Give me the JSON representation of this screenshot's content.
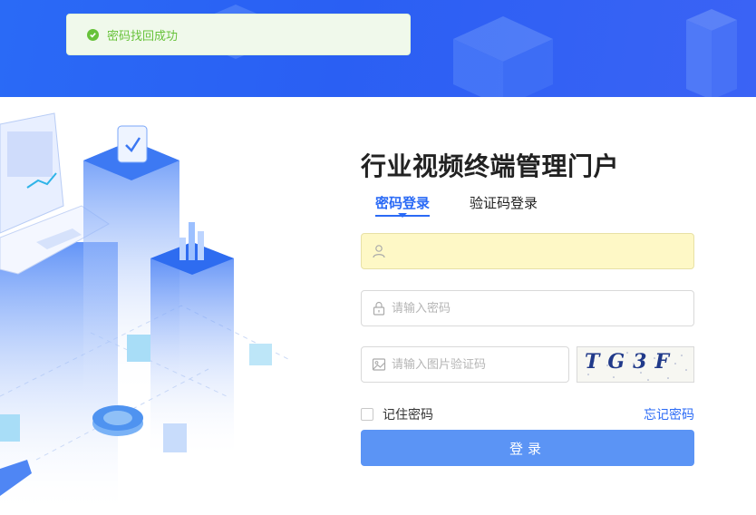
{
  "toast": {
    "message": "密码找回成功",
    "icon": "check-circle-icon",
    "color": "#67c23a"
  },
  "portal": {
    "title": "行业视频终端管理门户"
  },
  "tabs": [
    {
      "label": "密码登录",
      "active": true
    },
    {
      "label": "验证码登录",
      "active": false
    }
  ],
  "form": {
    "username": {
      "value": "",
      "placeholder": "",
      "icon": "user-icon"
    },
    "password": {
      "value": "",
      "placeholder": "请输入密码",
      "icon": "lock-icon"
    },
    "captcha": {
      "value": "",
      "placeholder": "请输入图片验证码",
      "icon": "image-icon",
      "image_text": "TG3F"
    },
    "remember_label": "记住密码",
    "forgot_label": "忘记密码",
    "login_label": "登录"
  },
  "colors": {
    "primary": "#2a6af6",
    "button": "#5b94f5",
    "autofill": "#fef8c6"
  }
}
